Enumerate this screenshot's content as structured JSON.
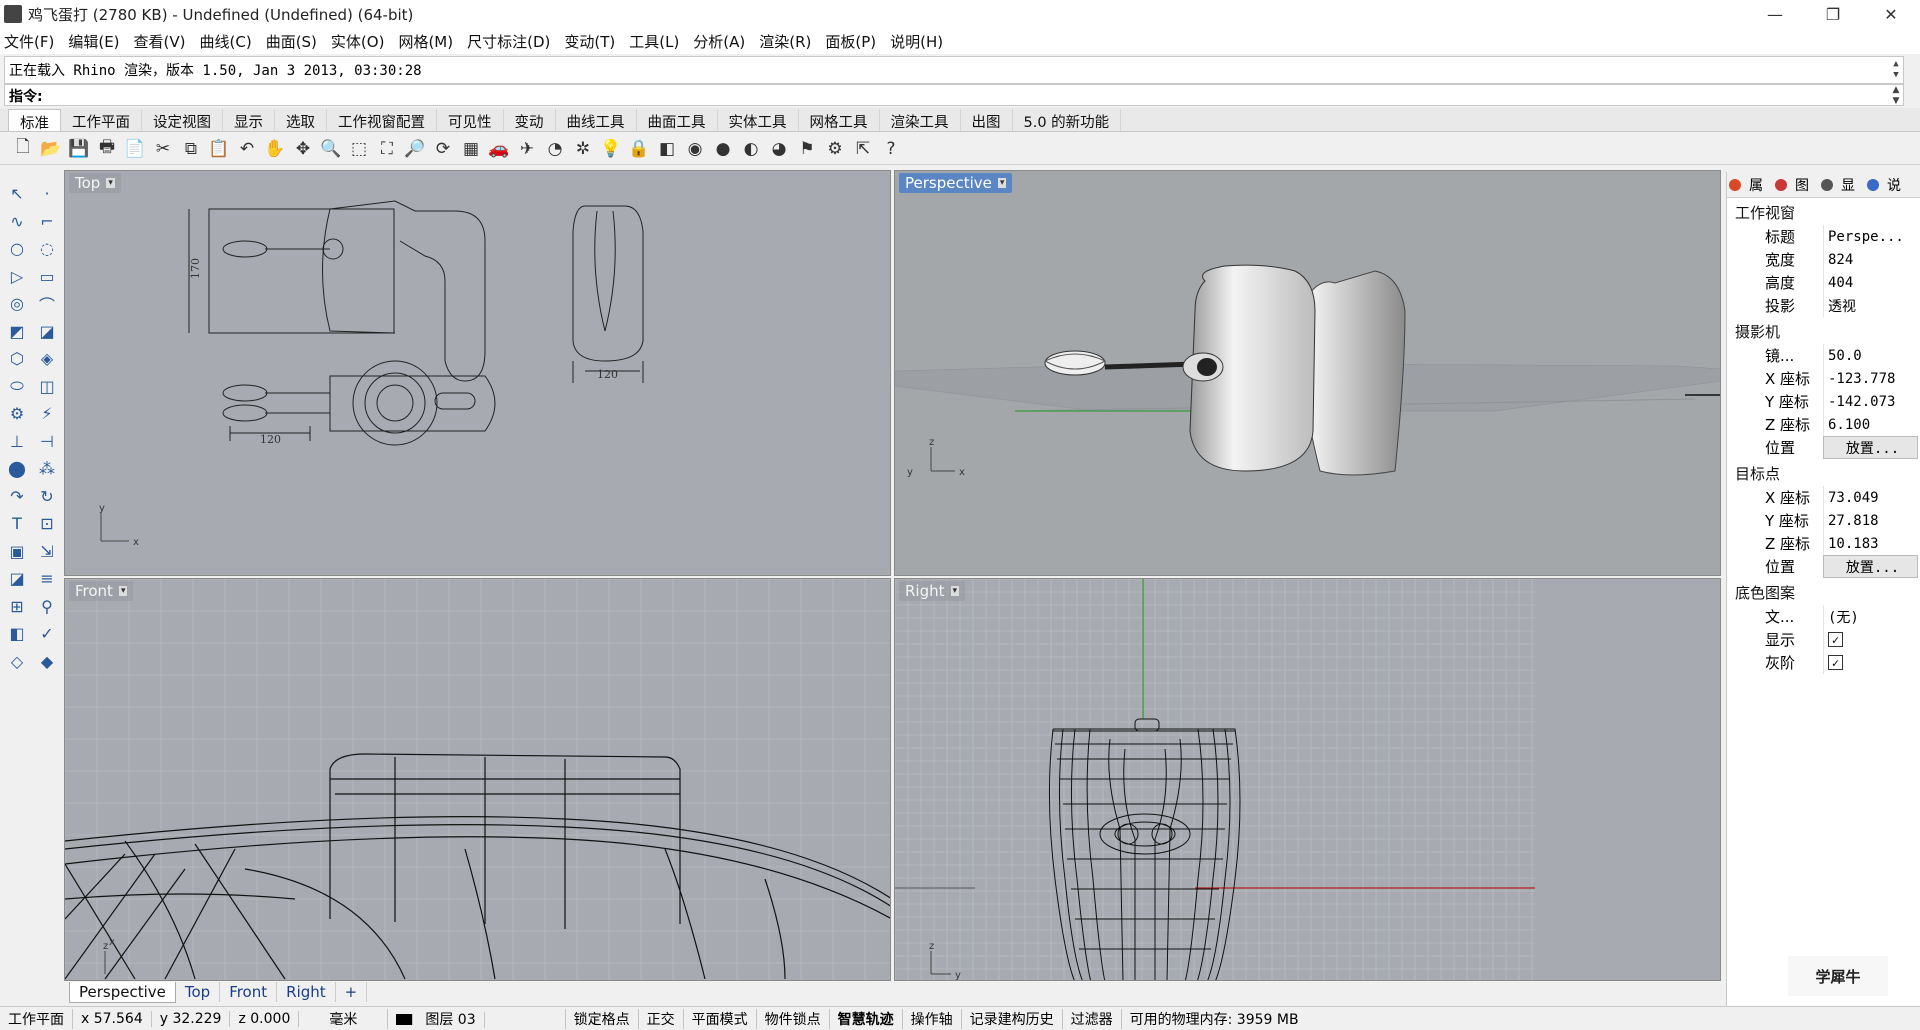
{
  "window": {
    "title": "鸡飞蛋打 (2780 KB) - Undefined (Undefined) (64-bit)",
    "min": "—",
    "max": "❐",
    "close": "✕"
  },
  "menu": [
    "文件(F)",
    "编辑(E)",
    "查看(V)",
    "曲线(C)",
    "曲面(S)",
    "实体(O)",
    "网格(M)",
    "尺寸标注(D)",
    "变动(T)",
    "工具(L)",
    "分析(A)",
    "渲染(R)",
    "面板(P)",
    "说明(H)"
  ],
  "command": {
    "history": "正在载入 Rhino 渲染，版本 1.50, Jan  3 2013, 03:30:28",
    "prompt": "指令:"
  },
  "tabs": [
    "标准",
    "工作平面",
    "设定视图",
    "显示",
    "选取",
    "工作视窗配置",
    "可见性",
    "变动",
    "曲线工具",
    "曲面工具",
    "实体工具",
    "网格工具",
    "渲染工具",
    "出图",
    "5.0 的新功能"
  ],
  "toolbar_icons": [
    "new-icon",
    "open-icon",
    "save-icon",
    "print-icon",
    "import-icon",
    "cut-icon",
    "copy-icon",
    "paste-icon",
    "undo-icon",
    "pan-icon",
    "move-icon",
    "zoom-icon",
    "zoom-window-icon",
    "zoom-extents-icon",
    "zoom-selected-icon",
    "rotate-view-icon",
    "grid-icon",
    "car-icon",
    "plane-icon",
    "clock-icon",
    "snap-icon",
    "light-icon",
    "lock-icon",
    "layer-icon",
    "color-wheel-icon",
    "sphere-icon",
    "material-icon",
    "render-icon",
    "flag-icon",
    "gear-icon",
    "pointer-icon",
    "help-icon"
  ],
  "toolbar_glyphs": [
    "🗋",
    "📂",
    "💾",
    "🖶",
    "📄",
    "✂",
    "⧉",
    "📋",
    "↶",
    "✋",
    "✥",
    "🔍",
    "⬚",
    "⛶",
    "🔎",
    "⟳",
    "▦",
    "🚗",
    "✈",
    "◔",
    "✲",
    "💡",
    "🔒",
    "◧",
    "◉",
    "●",
    "◐",
    "◕",
    "⚑",
    "⚙",
    "⇱",
    "?"
  ],
  "left_tools": [
    "↖",
    "·",
    "∿",
    "⌐",
    "○",
    "◌",
    "▷",
    "▭",
    "◎",
    "⌒",
    "◩",
    "◪",
    "⬡",
    "◈",
    "⬭",
    "◫",
    "⚙",
    "⚡",
    "⊥",
    "⊣",
    "⬤",
    "⁂",
    "↷",
    "↻",
    "T",
    "⊡",
    "▣",
    "⇲",
    "◪",
    "≡",
    "⊞",
    "⚲",
    "◧",
    "✓",
    "◇",
    "◆"
  ],
  "viewports": {
    "top": {
      "label": "Top",
      "dims": [
        "170",
        "120",
        "120"
      ]
    },
    "perspective": {
      "label": "Perspective"
    },
    "front": {
      "label": "Front"
    },
    "right": {
      "label": "Right"
    }
  },
  "viewport_tabs": [
    "Perspective",
    "Top",
    "Front",
    "Right",
    "+"
  ],
  "panel": {
    "tabs": [
      {
        "label": "属",
        "color": "#d84a2a"
      },
      {
        "label": "图",
        "color": "#c83838"
      },
      {
        "label": "显",
        "color": "#555555"
      },
      {
        "label": "说",
        "color": "#3a6ac8"
      }
    ],
    "section_viewport": "工作视窗",
    "rows_viewport": [
      {
        "label": "标题",
        "value": "Perspe..."
      },
      {
        "label": "宽度",
        "value": "824"
      },
      {
        "label": "高度",
        "value": "404"
      },
      {
        "label": "投影",
        "value": "透视"
      }
    ],
    "section_camera": "摄影机",
    "rows_camera": [
      {
        "label": "镜...",
        "value": "50.0"
      },
      {
        "label": "X 座标",
        "value": "-123.778"
      },
      {
        "label": "Y 座标",
        "value": "-142.073"
      },
      {
        "label": "Z 座标",
        "value": "6.100"
      },
      {
        "label": "位置",
        "value": "放置..."
      }
    ],
    "section_target": "目标点",
    "rows_target": [
      {
        "label": "X 座标",
        "value": "73.049"
      },
      {
        "label": "Y 座标",
        "value": "27.818"
      },
      {
        "label": "Z 座标",
        "value": "10.183"
      },
      {
        "label": "位置",
        "value": "放置..."
      }
    ],
    "section_bg": "底色图案",
    "rows_bg": [
      {
        "label": "文...",
        "value": "(无)"
      },
      {
        "label": "显示",
        "value": "✓"
      },
      {
        "label": "灰阶",
        "value": "✓"
      }
    ]
  },
  "status": {
    "cplane": "工作平面",
    "x": "x 57.564",
    "y": "y 32.229",
    "z": "z 0.000",
    "unit": "毫米",
    "layer": "图层 03",
    "items": [
      "锁定格点",
      "正交",
      "平面模式",
      "物件锁点",
      "智慧轨迹",
      "操作轴",
      "记录建构历史",
      "过滤器"
    ],
    "memory": "可用的物理内存: 3959 MB"
  },
  "logo": "学犀牛"
}
